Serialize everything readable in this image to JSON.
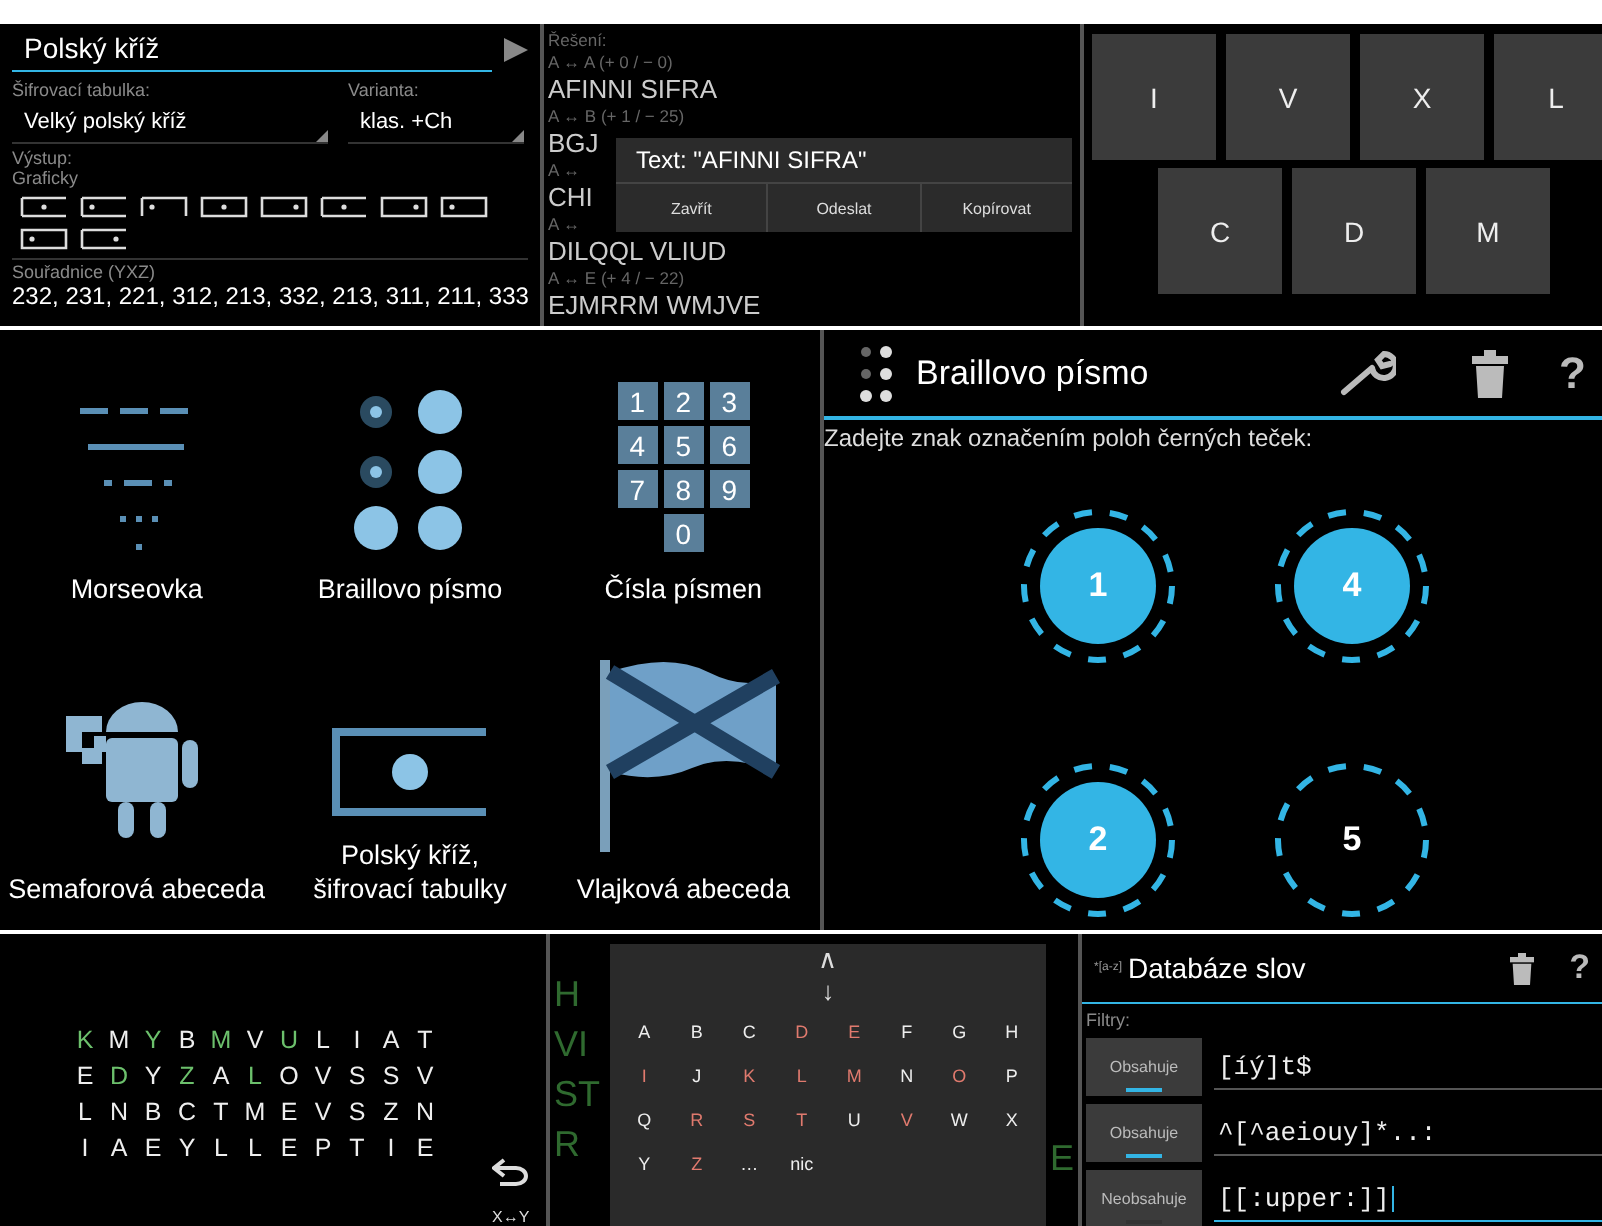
{
  "cipher_panel": {
    "search": {
      "value": "Polský kříž"
    },
    "table_label": "Šifrovací tabulka:",
    "variant_label": "Varianta:",
    "table_value": "Velký polský kříž",
    "variant_value": "klas. +Ch",
    "output_label": "Výstup:",
    "output_mode": "Graficky",
    "coords_label": "Souřadnice (YXZ)",
    "coords": "232, 231, 221, 312, 213, 332, 213, 311, 211, 333"
  },
  "solution_panel": {
    "label": "Řešení:",
    "lines": [
      {
        "kind": "shift",
        "text": "A ↔ A (+ 0 / − 0)"
      },
      {
        "kind": "result",
        "text": "AFINNI SIFRA"
      },
      {
        "kind": "shift",
        "text": "A ↔ B (+ 1 / − 25)"
      },
      {
        "kind": "result",
        "text": "BGJ"
      },
      {
        "kind": "shift",
        "text": "A ↔"
      },
      {
        "kind": "result",
        "text": "CHI"
      },
      {
        "kind": "shift",
        "text": "A ↔"
      },
      {
        "kind": "result",
        "text": "DILQQL VLIUD"
      },
      {
        "kind": "shift",
        "text": "A ↔ E (+ 4 / − 22)"
      },
      {
        "kind": "result",
        "text": "EJMRRM WMJVE"
      }
    ],
    "dialog": {
      "title": "Text: \"AFINNI SIFRA\"",
      "buttons": [
        "Zavřít",
        "Odeslat",
        "Kopírovat"
      ]
    }
  },
  "roman_keys": [
    [
      "I",
      "V",
      "X",
      "L"
    ],
    [
      "C",
      "D",
      "M"
    ]
  ],
  "menu": [
    {
      "kind": "morse",
      "label": "Morseovka"
    },
    {
      "kind": "braille",
      "label": "Braillovo písmo"
    },
    {
      "kind": "keypad",
      "label": "Čísla písmen",
      "keys": [
        "1",
        "2",
        "3",
        "4",
        "5",
        "6",
        "7",
        "8",
        "9",
        "0"
      ]
    },
    {
      "kind": "semaphore",
      "label": "Semaforová abeceda"
    },
    {
      "kind": "cross",
      "label": "Polský kříž,\nšifrovací tabulky"
    },
    {
      "kind": "flag",
      "label": "Vlajková abeceda"
    }
  ],
  "braille": {
    "title": "Braillovo písmo",
    "help": "?",
    "prompt": "Zadejte znak označením poloh černých teček:",
    "dots": [
      {
        "label": "1",
        "selected": true
      },
      {
        "label": "4",
        "selected": true
      },
      {
        "label": "2",
        "selected": true
      },
      {
        "label": "5",
        "selected": false
      }
    ]
  },
  "letter_grid": {
    "rows": [
      [
        {
          "letter": "K",
          "found": true
        },
        {
          "letter": "M",
          "found": false
        },
        {
          "letter": "Y",
          "found": true
        },
        {
          "letter": "B",
          "found": false
        },
        {
          "letter": "M",
          "found": true
        },
        {
          "letter": "V",
          "found": false
        },
        {
          "letter": "U",
          "found": true
        },
        {
          "letter": "L",
          "found": false
        },
        {
          "letter": "I",
          "found": false
        },
        {
          "letter": "A",
          "found": false
        },
        {
          "letter": "T",
          "found": false
        }
      ],
      [
        {
          "letter": "E",
          "found": false
        },
        {
          "letter": "D",
          "found": true
        },
        {
          "letter": "Y",
          "found": false
        },
        {
          "letter": "Z",
          "found": true
        },
        {
          "letter": "A",
          "found": false
        },
        {
          "letter": "L",
          "found": true
        },
        {
          "letter": "O",
          "found": false
        },
        {
          "letter": "V",
          "found": false
        },
        {
          "letter": "S",
          "found": false
        },
        {
          "letter": "S",
          "found": false
        },
        {
          "letter": "V",
          "found": false
        }
      ],
      [
        {
          "letter": "L",
          "found": false
        },
        {
          "letter": "N",
          "found": false
        },
        {
          "letter": "B",
          "found": false
        },
        {
          "letter": "C",
          "found": false
        },
        {
          "letter": "T",
          "found": false
        },
        {
          "letter": "M",
          "found": false
        },
        {
          "letter": "E",
          "found": false
        },
        {
          "letter": "V",
          "found": false
        },
        {
          "letter": "S",
          "found": false
        },
        {
          "letter": "Z",
          "found": false
        },
        {
          "letter": "N",
          "found": false
        }
      ],
      [
        {
          "letter": "I",
          "found": false
        },
        {
          "letter": "A",
          "found": false
        },
        {
          "letter": "E",
          "found": false
        },
        {
          "letter": "Y",
          "found": false
        },
        {
          "letter": "L",
          "found": false
        },
        {
          "letter": "L",
          "found": false
        },
        {
          "letter": "E",
          "found": false
        },
        {
          "letter": "P",
          "found": false
        },
        {
          "letter": "T",
          "found": false
        },
        {
          "letter": "I",
          "found": false
        },
        {
          "letter": "E",
          "found": false
        }
      ]
    ],
    "swap_label": "X↔Y"
  },
  "keyboard": {
    "background_text": [
      "H",
      "VI",
      "ST",
      "R"
    ],
    "background_right": "E",
    "top_keys": [
      "∧",
      "↓"
    ],
    "keys": [
      {
        "label": "A",
        "marked": false
      },
      {
        "label": "B",
        "marked": false
      },
      {
        "label": "C",
        "marked": false
      },
      {
        "label": "D",
        "marked": true
      },
      {
        "label": "E",
        "marked": true
      },
      {
        "label": "F",
        "marked": false
      },
      {
        "label": "G",
        "marked": false
      },
      {
        "label": "H",
        "marked": false
      },
      {
        "label": "I",
        "marked": true
      },
      {
        "label": "J",
        "marked": false
      },
      {
        "label": "K",
        "marked": true
      },
      {
        "label": "L",
        "marked": true
      },
      {
        "label": "M",
        "marked": true
      },
      {
        "label": "N",
        "marked": false
      },
      {
        "label": "O",
        "marked": true
      },
      {
        "label": "P",
        "marked": false
      },
      {
        "label": "Q",
        "marked": false
      },
      {
        "label": "R",
        "marked": true
      },
      {
        "label": "S",
        "marked": true
      },
      {
        "label": "T",
        "marked": true
      },
      {
        "label": "U",
        "marked": false
      },
      {
        "label": "V",
        "marked": true
      },
      {
        "label": "W",
        "marked": false
      },
      {
        "label": "X",
        "marked": false
      },
      {
        "label": "Y",
        "marked": false
      },
      {
        "label": "Z",
        "marked": true
      },
      {
        "label": "…",
        "marked": false
      },
      {
        "label": "nic",
        "marked": false
      }
    ]
  },
  "word_db": {
    "logo": "*[a-z]",
    "title": "Databáze slov",
    "help": "?",
    "filters_label": "Filtry:",
    "filters": [
      {
        "mode": "Obsahuje",
        "on": true,
        "pattern": "[íý]t$",
        "focused": false
      },
      {
        "mode": "Obsahuje",
        "on": true,
        "pattern": "^[^aeiouy]*..:",
        "focused": false
      },
      {
        "mode": "Neobsahuje",
        "on": false,
        "pattern": "[[:upper:]]",
        "focused": true
      }
    ]
  }
}
